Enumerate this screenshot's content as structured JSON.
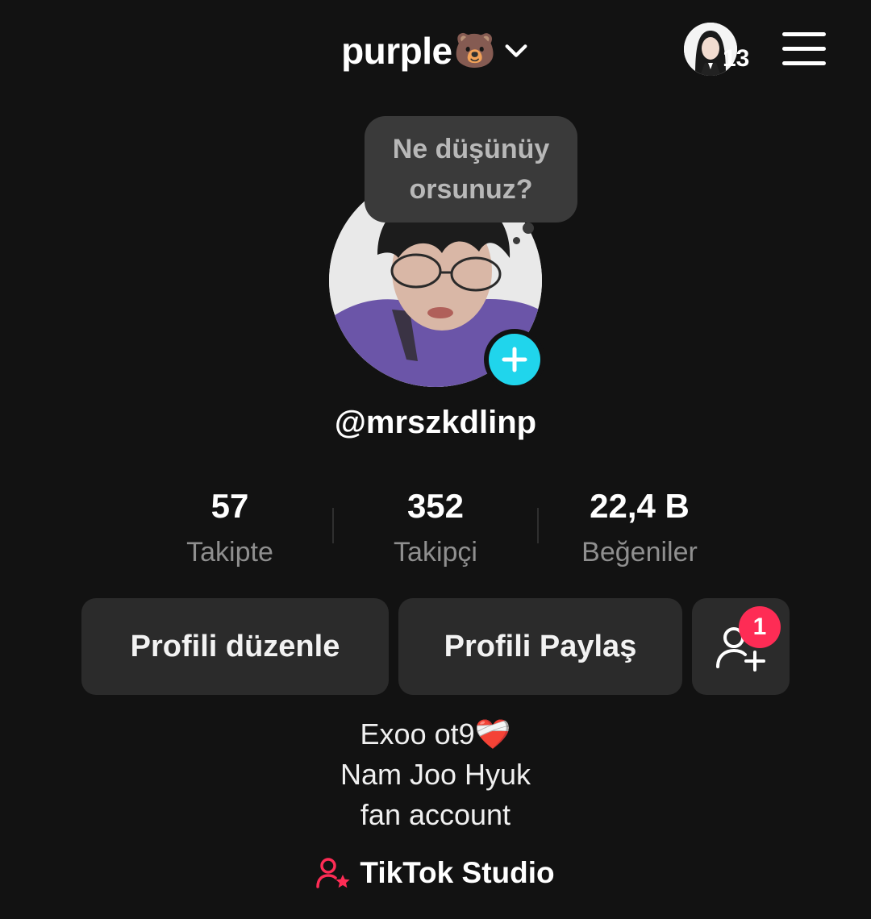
{
  "header": {
    "title": "purple",
    "title_emoji": "🐻",
    "story_count": "13"
  },
  "profile": {
    "thought_line1": "Ne düşünüy",
    "thought_line2": "orsunuz?",
    "username": "@mrszkdlinp"
  },
  "stats": [
    {
      "value": "57",
      "label": "Takipte"
    },
    {
      "value": "352",
      "label": "Takipçi"
    },
    {
      "value": "22,4 B",
      "label": "Beğeniler"
    }
  ],
  "actions": {
    "edit_label": "Profili düzenle",
    "share_label": "Profili Paylaş",
    "add_friends_badge": "1"
  },
  "bio": {
    "line1": "Exoo ot9❤️‍🩹",
    "line2": "Nam Joo Hyuk",
    "line3": "fan account"
  },
  "studio": {
    "label": "TikTok Studio",
    "icon": "person-star-icon"
  },
  "colors": {
    "background": "#121212",
    "accent_cyan": "#20d5ec",
    "accent_red": "#fe2c55",
    "button_bg": "#2b2b2b"
  }
}
